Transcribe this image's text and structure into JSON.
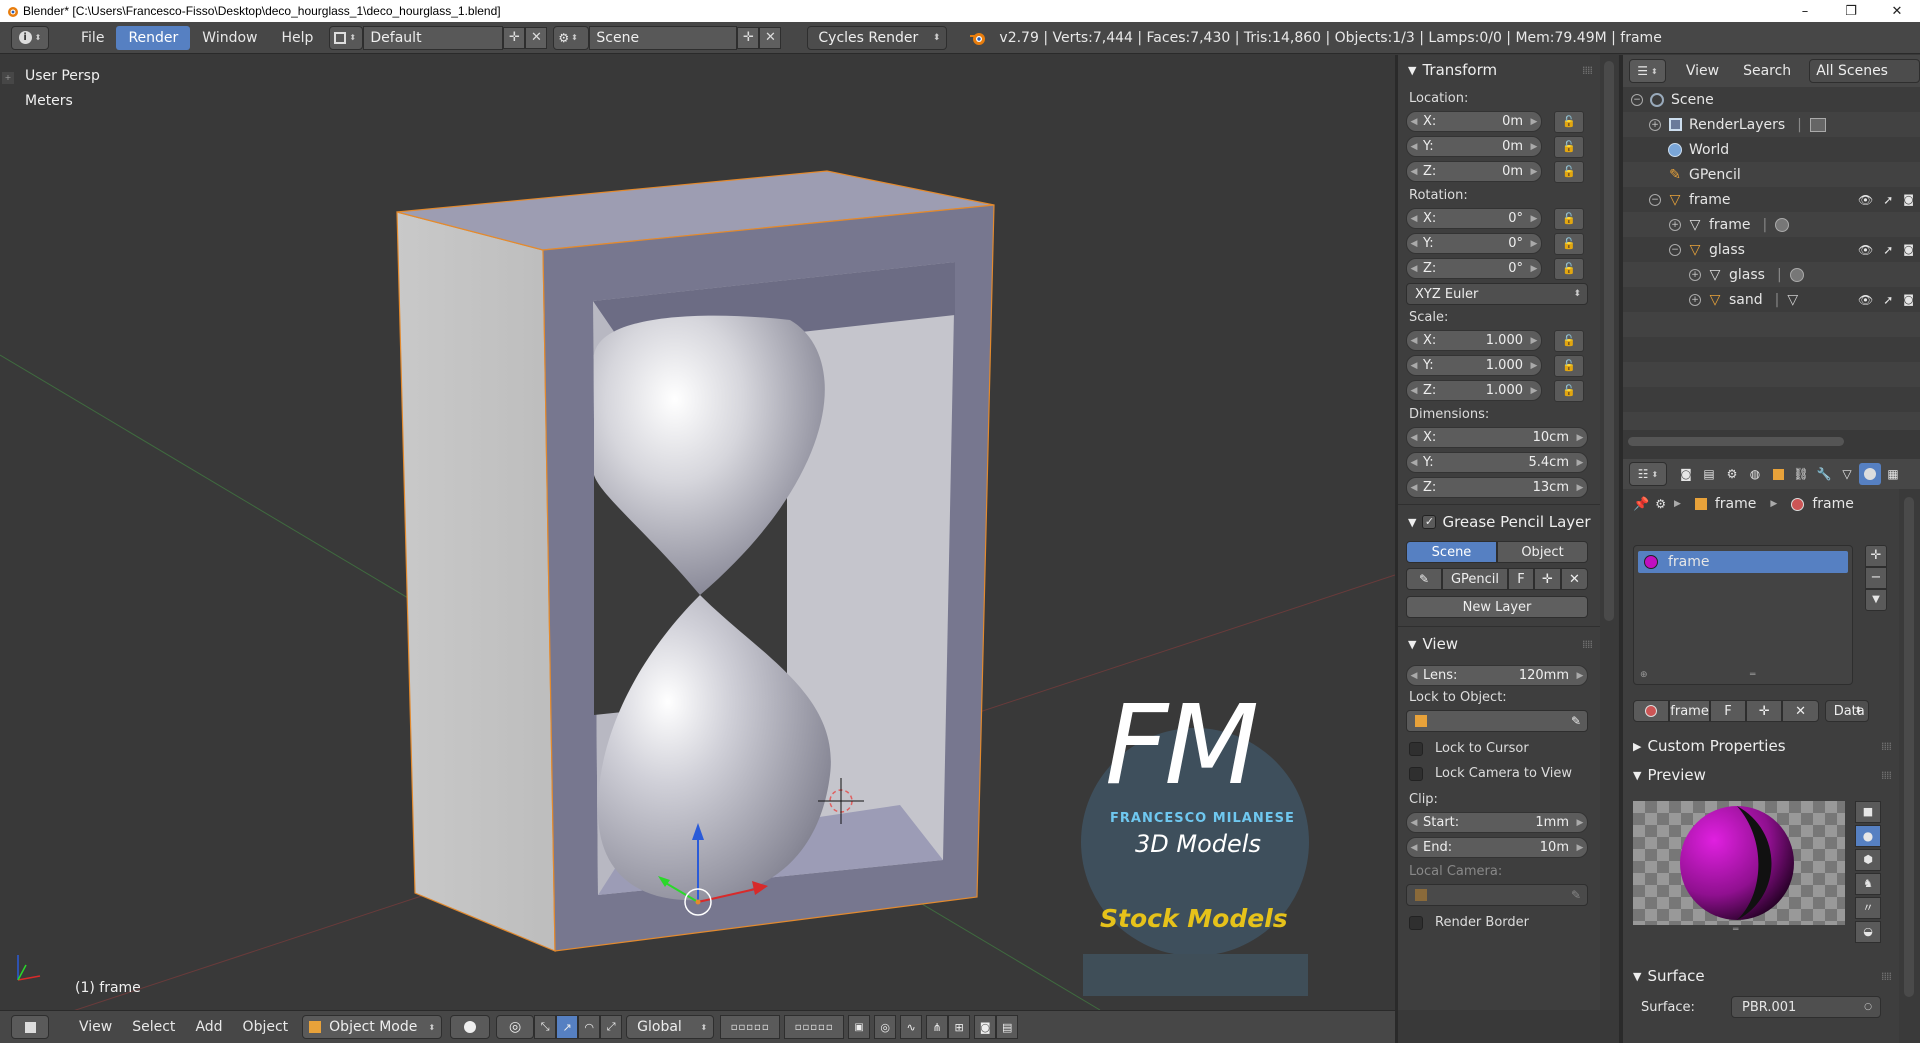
{
  "window": {
    "title": "Blender* [C:\\Users\\Francesco-Fisso\\Desktop\\deco_hourglass_1\\deco_hourglass_1.blend]",
    "minimize": "–",
    "maximize": "❐",
    "close": "✕"
  },
  "info_header": {
    "menus": [
      "File",
      "Render",
      "Window",
      "Help"
    ],
    "active_menu": "Render",
    "screen_layout": "Default",
    "scene": "Scene",
    "render_engine": "Cycles Render",
    "stats": "v2.79 | Verts:7,444 | Faces:7,430 | Tris:14,860 | Objects:1/3 | Lamps:0/0 | Mem:79.49M | frame"
  },
  "viewport": {
    "view_name": "User Persp",
    "units": "Meters",
    "active_object_label": "(1) frame",
    "watermark": {
      "logo_letters": "FM",
      "author": "FRANCESCO MILANESE",
      "subtitle": "3D Models",
      "badge": "Stock Models"
    }
  },
  "viewport_footer": {
    "menus": [
      "View",
      "Select",
      "Add",
      "Object"
    ],
    "mode": "Object Mode",
    "orientation": "Global"
  },
  "n_panel": {
    "transform": {
      "title": "Transform",
      "location_label": "Location:",
      "location": [
        {
          "axis": "X:",
          "value": "0m"
        },
        {
          "axis": "Y:",
          "value": "0m"
        },
        {
          "axis": "Z:",
          "value": "0m"
        }
      ],
      "rotation_label": "Rotation:",
      "rotation": [
        {
          "axis": "X:",
          "value": "0°"
        },
        {
          "axis": "Y:",
          "value": "0°"
        },
        {
          "axis": "Z:",
          "value": "0°"
        }
      ],
      "rotation_mode": "XYZ Euler",
      "scale_label": "Scale:",
      "scale": [
        {
          "axis": "X:",
          "value": "1.000"
        },
        {
          "axis": "Y:",
          "value": "1.000"
        },
        {
          "axis": "Z:",
          "value": "1.000"
        }
      ],
      "dimensions_label": "Dimensions:",
      "dimensions": [
        {
          "axis": "X:",
          "value": "10cm"
        },
        {
          "axis": "Y:",
          "value": "5.4cm"
        },
        {
          "axis": "Z:",
          "value": "13cm"
        }
      ]
    },
    "grease_pencil": {
      "title": "Grease Pencil Layer",
      "tabs": [
        "Scene",
        "Object"
      ],
      "active_tab": "Scene",
      "datablock": "GPencil",
      "fake_user": "F",
      "new_layer": "New Layer"
    },
    "view": {
      "title": "View",
      "lens_label": "Lens:",
      "lens_value": "120mm",
      "lock_to_object": "Lock to Object:",
      "lock_to_cursor": "Lock to Cursor",
      "lock_camera_to_view": "Lock Camera to View",
      "clip_label": "Clip:",
      "clip_start_label": "Start:",
      "clip_start": "1mm",
      "clip_end_label": "End:",
      "clip_end": "10m",
      "local_camera": "Local Camera:",
      "render_border": "Render Border"
    }
  },
  "outliner": {
    "menus": [
      "View",
      "Search"
    ],
    "display_mode": "All Scenes",
    "items": [
      {
        "label": "Scene",
        "icon": "scene-icon"
      },
      {
        "label": "RenderLayers",
        "icon": "render-layers-icon"
      },
      {
        "label": "World",
        "icon": "world-icon"
      },
      {
        "label": "GPencil",
        "icon": "grease-pencil-icon"
      },
      {
        "label": "frame",
        "icon": "object-mesh-icon"
      },
      {
        "label": "frame",
        "icon": "mesh-data-icon"
      },
      {
        "label": "glass",
        "icon": "object-mesh-icon"
      },
      {
        "label": "glass",
        "icon": "mesh-data-icon"
      },
      {
        "label": "sand",
        "icon": "object-mesh-icon"
      }
    ]
  },
  "properties": {
    "breadcrumb": [
      "frame",
      "frame"
    ],
    "material_slot": "frame",
    "material_name": "frame",
    "fake_user": "F",
    "link": "Data",
    "custom_properties": "Custom Properties",
    "preview": "Preview",
    "surface": "Surface",
    "surface_label": "Surface:",
    "surface_shader": "PBR.001"
  },
  "colors": {
    "accent": "#5680c2",
    "background": "#393939",
    "panel": "#3e3e3e",
    "header": "#474747",
    "selection_outline": "#e38a2e",
    "watermark_badge": "#e6c21a"
  }
}
